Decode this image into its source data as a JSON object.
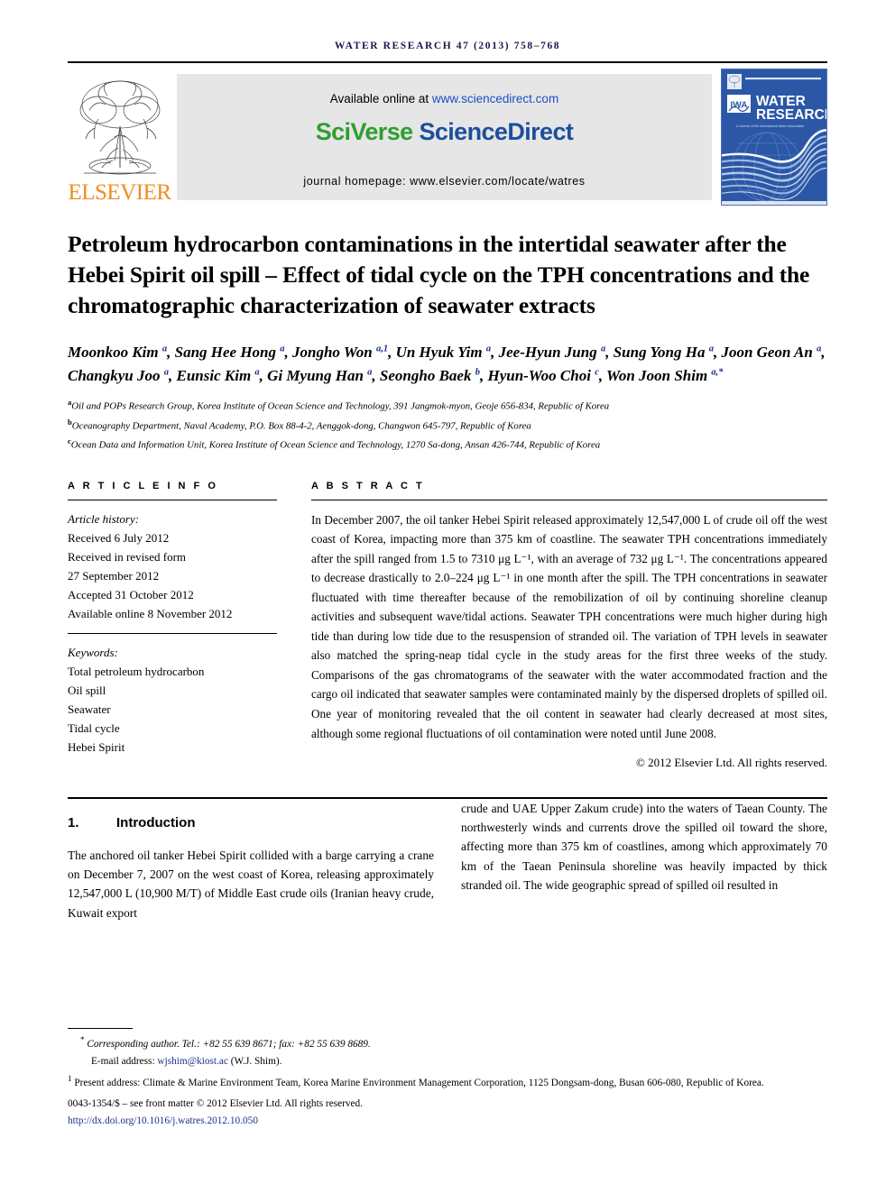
{
  "running_head": "WATER RESEARCH 47 (2013) 758–768",
  "masthead": {
    "publisher_name": "ELSEVIER",
    "available_prefix": "Available online at ",
    "available_url": "www.sciencedirect.com",
    "logo_sci": "Sci",
    "logo_verse": "Verse",
    "logo_science": "Science",
    "logo_direct": "Direct",
    "journal_homepage": "journal homepage: www.elsevier.com/locate/watres",
    "cover_title_line1": "WATER",
    "cover_title_line2": "RESEARCH",
    "cover_subtitle": "A Journal of the International Water Association",
    "cover_badge": "IWA",
    "colors": {
      "elsevier_orange": "#f08c20",
      "sciverse_green": "#2f9e2f",
      "sciencedirect_blue": "#1b4f9c",
      "cover_blue": "#2b57a6",
      "link_blue": "#1b2f8f"
    }
  },
  "title": "Petroleum hydrocarbon contaminations in the intertidal seawater after the Hebei Spirit oil spill – Effect of tidal cycle on the TPH concentrations and the chromatographic characterization of seawater extracts",
  "authors_html": "Moonkoo Kim <sup>a</sup>, Sang Hee Hong <sup>a</sup>, Jongho Won <sup>a,1</sup>, Un Hyuk Yim <sup>a</sup>, Jee-Hyun Jung <sup>a</sup>, Sung Yong Ha <sup>a</sup>, Joon Geon An <sup>a</sup>, Changkyu Joo <sup>a</sup>, Eunsic Kim <sup>a</sup>, Gi Myung Han <sup>a</sup>, Seongho Baek <sup>b</sup>, Hyun-Woo Choi <sup>c</sup>, Won Joon Shim <sup>a,*</sup>",
  "affiliations": [
    {
      "marker": "a",
      "text": "Oil and POPs Research Group, Korea Institute of Ocean Science and Technology, 391 Jangmok-myon, Geoje 656-834, Republic of Korea"
    },
    {
      "marker": "b",
      "text": "Oceanography Department, Naval Academy, P.O. Box 88-4-2, Aenggok-dong, Changwon 645-797, Republic of Korea"
    },
    {
      "marker": "c",
      "text": "Ocean Data and Information Unit, Korea Institute of Ocean Science and Technology, 1270 Sa-dong, Ansan 426-744, Republic of Korea"
    }
  ],
  "article_info": {
    "heading": "A R T I C L E   I N F O",
    "history_label": "Article history:",
    "history": [
      "Received 6 July 2012",
      "Received in revised form",
      "27 September 2012",
      "Accepted 31 October 2012",
      "Available online 8 November 2012"
    ],
    "keywords_label": "Keywords:",
    "keywords": [
      "Total petroleum hydrocarbon",
      "Oil spill",
      "Seawater",
      "Tidal cycle",
      "Hebei Spirit"
    ]
  },
  "abstract": {
    "heading": "A B S T R A C T",
    "text": "In December 2007, the oil tanker Hebei Spirit released approximately 12,547,000 L of crude oil off the west coast of Korea, impacting more than 375 km of coastline. The seawater TPH concentrations immediately after the spill ranged from 1.5 to 7310 μg L⁻¹, with an average of 732 μg L⁻¹. The concentrations appeared to decrease drastically to 2.0–224 μg L⁻¹ in one month after the spill. The TPH concentrations in seawater fluctuated with time thereafter because of the remobilization of oil by continuing shoreline cleanup activities and subsequent wave/tidal actions. Seawater TPH concentrations were much higher during high tide than during low tide due to the resuspension of stranded oil. The variation of TPH levels in seawater also matched the spring-neap tidal cycle in the study areas for the first three weeks of the study. Comparisons of the gas chromatograms of the seawater with the water accommodated fraction and the cargo oil indicated that seawater samples were contaminated mainly by the dispersed droplets of spilled oil. One year of monitoring revealed that the oil content in seawater had clearly decreased at most sites, although some regional fluctuations of oil contamination were noted until June 2008.",
    "copyright": "© 2012 Elsevier Ltd. All rights reserved."
  },
  "body": {
    "section_number": "1.",
    "section_title": "Introduction",
    "left_paragraph": "The anchored oil tanker Hebei Spirit collided with a barge carrying a crane on December 7, 2007 on the west coast of Korea, releasing approximately 12,547,000 L (10,900 M/T) of Middle East crude oils (Iranian heavy crude, Kuwait export",
    "right_paragraph": "crude and UAE Upper Zakum crude) into the waters of Taean County. The northwesterly winds and currents drove the spilled oil toward the shore, affecting more than 375 km of coastlines, among which approximately 70 km of the Taean Peninsula shoreline was heavily impacted by thick stranded oil. The wide geographic spread of spilled oil resulted in"
  },
  "footnotes": {
    "corresponding_mark": "*",
    "corresponding": "Corresponding author. Tel.: +82 55 639 8671; fax: +82 55 639 8689.",
    "email_label": "E-mail address: ",
    "email": "wjshim@kiost.ac",
    "email_suffix": " (W.J. Shim).",
    "present_mark": "1",
    "present_address": "Present address: Climate & Marine Environment Team, Korea Marine Environment Management Corporation, 1125 Dongsam-dong, Busan 606-080, Republic of Korea.",
    "issn_line": "0043-1354/$ – see front matter © 2012 Elsevier Ltd. All rights reserved.",
    "doi": "http://dx.doi.org/10.1016/j.watres.2012.10.050"
  }
}
